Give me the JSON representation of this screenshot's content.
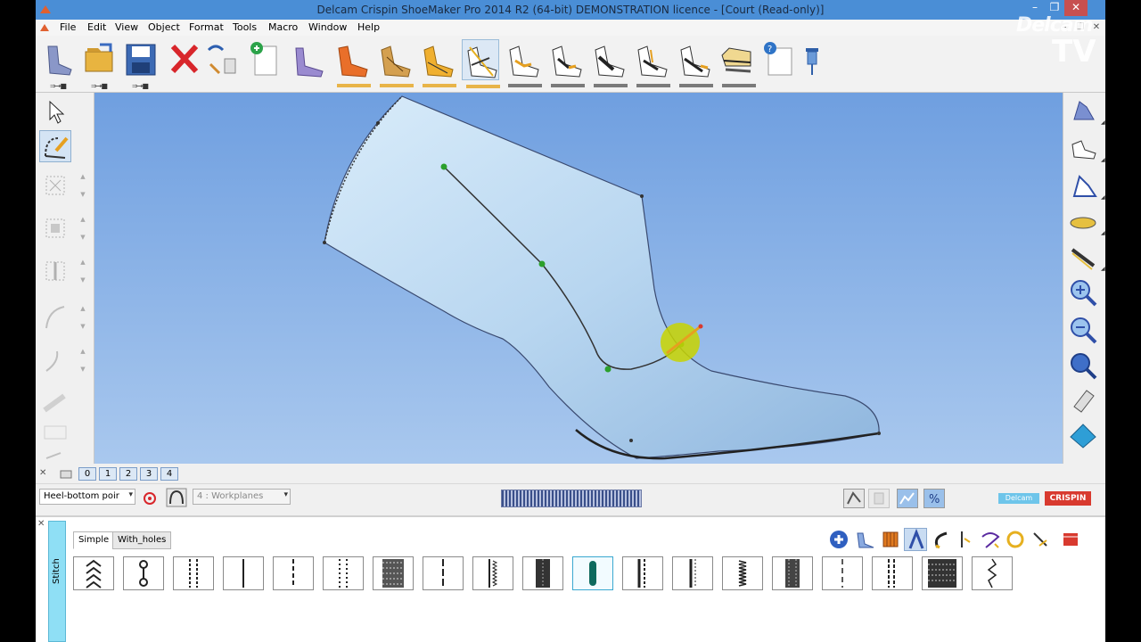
{
  "window": {
    "title": "Delcam Crispin ShoeMaker Pro 2014 R2 (64-bit) DEMONSTRATION licence - [Court (Read-only)]",
    "controls": {
      "minimize": "–",
      "maximize": "❐",
      "close": "✕"
    }
  },
  "menu": {
    "items": [
      "File",
      "Edit",
      "View",
      "Object",
      "Format",
      "Tools",
      "Macro",
      "Window",
      "Help"
    ],
    "mdi_controls": [
      "–",
      "❐",
      "✕"
    ]
  },
  "toolbar": {
    "arrows": [
      "⇒→■",
      "⇒→■",
      "⇒→■"
    ]
  },
  "parts_tabs": {
    "close": "✕",
    "labels": [
      "0",
      "1",
      "2",
      "3",
      "4"
    ]
  },
  "status": {
    "selector_value": "Heel-bottom poir",
    "workplanes_value": "4 : Workplanes",
    "brand_delcam": "Delcam",
    "brand_crispin": "CRISPIN"
  },
  "library": {
    "close": "✕",
    "sidebar_label": "Stitch",
    "tabs": [
      "Simple",
      "With_holes"
    ],
    "active_tab": "Simple",
    "stitch_count": 19,
    "selected_stitch": 10
  },
  "watermark": {
    "brand": "Delcam",
    "tv": "TV"
  },
  "colors": {
    "titlebar": "#4a8ed6",
    "viewport_top": "#6f9fe0",
    "viewport_bottom": "#a9c8ee",
    "shoe_body": "#b8d6f0",
    "control_point": "#2ca02c",
    "highlight": "#c8d400",
    "accent_strip": "#e8b448"
  }
}
